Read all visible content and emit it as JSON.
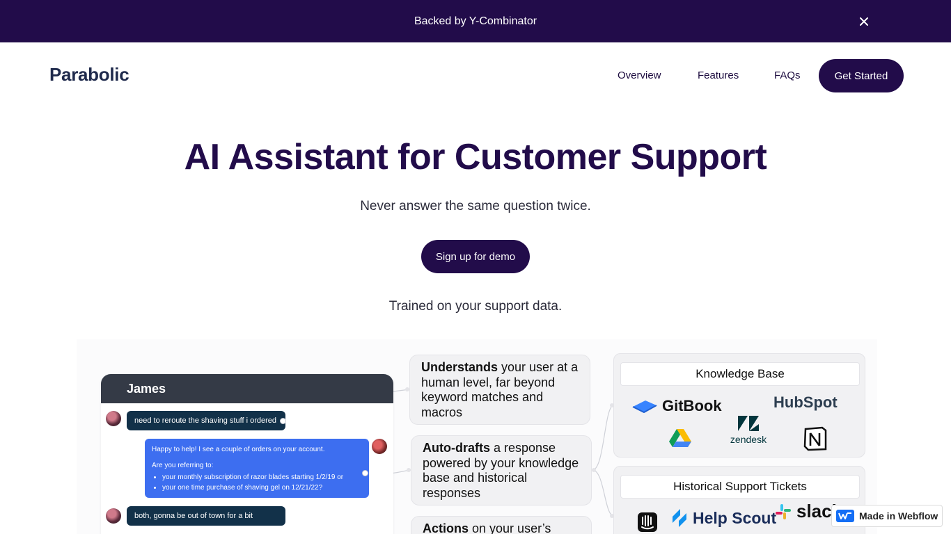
{
  "banner": {
    "text": "Backed by Y-Combinator",
    "close_icon": "close-icon",
    "background": "#220c4a"
  },
  "nav": {
    "logo": "Parabolic",
    "links": [
      "Overview",
      "Features",
      "FAQs"
    ],
    "cta": "Get Started"
  },
  "hero": {
    "title": "AI Assistant for Customer Support",
    "subtitle": "Never answer the same question twice.",
    "demo_button": "Sign up for demo",
    "trained_text": "Trained on your support data."
  },
  "chat": {
    "name": "James",
    "messages": [
      {
        "from": "user",
        "text": "need to reroute the shaving stuff i ordered"
      },
      {
        "from": "agent",
        "line1": "Happy to help! I see a couple of orders on your account.",
        "line2": "Are you referring to:",
        "bullets": [
          "your monthly subscription of razor blades starting 1/2/19 or",
          "your one time purchase of shaving gel on 12/21/22?"
        ]
      },
      {
        "from": "user",
        "text": "both, gonna be out of town for a bit"
      }
    ]
  },
  "features": [
    {
      "bold": "Understands",
      "rest": " your user at a human level, far beyond keyword matches and macros"
    },
    {
      "bold": "Auto-drafts",
      "rest": " a response powered by your knowledge base and historical responses"
    },
    {
      "bold": "Actions",
      "rest": " on your user’s"
    }
  ],
  "knowledge_base": {
    "title": "Knowledge Base",
    "logos": {
      "gitbook": "GitBook",
      "hubspot": "HubSpot",
      "zendesk": "zendesk",
      "gdrive": "google-drive-icon",
      "notion": "notion-icon"
    }
  },
  "historical": {
    "title": "Historical Support Tickets",
    "logos": {
      "intercom": "intercom-icon",
      "helpscout": "Help Scout",
      "slack": "slack"
    }
  },
  "webflow_badge": "Made in Webflow",
  "colors": {
    "primary": "#220c4a",
    "chat_header": "#343a46",
    "user_bubble": "#123149",
    "agent_bubble": "#3d6ef0"
  }
}
